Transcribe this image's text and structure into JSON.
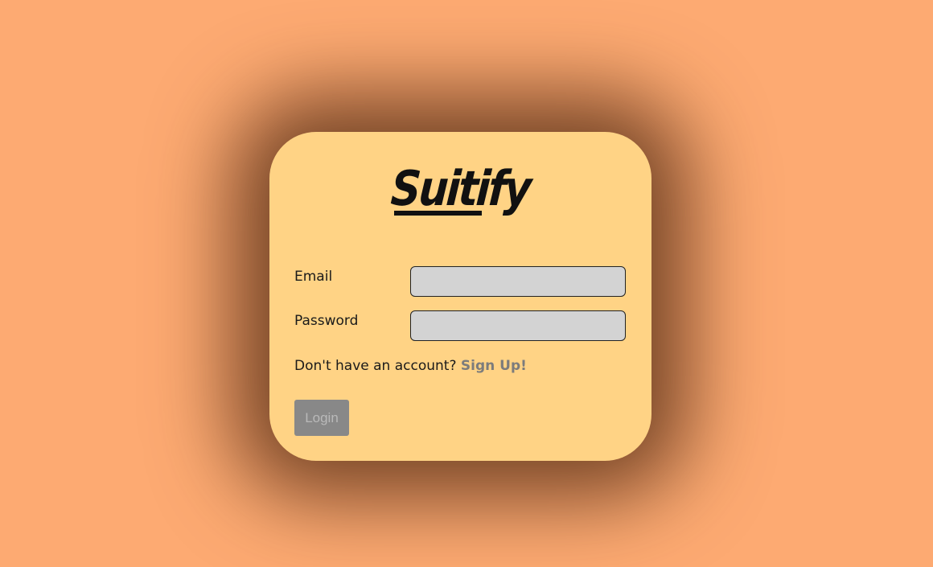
{
  "app": {
    "logo_text": "Suitify"
  },
  "form": {
    "email_label": "Email",
    "email_value": "",
    "password_label": "Password",
    "password_value": "",
    "signup_prompt": "Don't have an account?",
    "signup_link": "Sign Up!",
    "login_label": "Login"
  },
  "colors": {
    "page_background": "#fdaa72",
    "card_background": "#ffd385",
    "input_background": "#d3d3d3",
    "button_background": "#888888",
    "link_color": "#7c7c7c"
  }
}
